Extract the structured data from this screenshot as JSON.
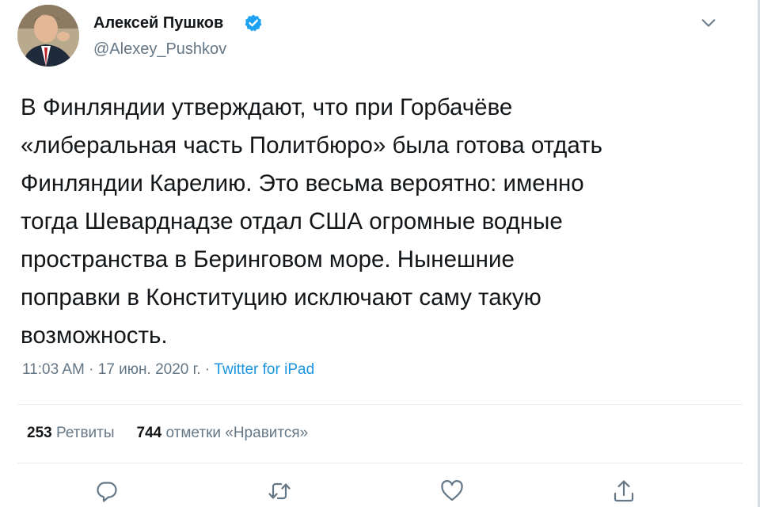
{
  "author": {
    "name": "Алексей Пушков",
    "handle": "@Alexey_Pushkov"
  },
  "tweet": {
    "text": "В Финляндии утверждают, что при Горбачёве\n«либеральная часть Политбюро» была готова отдать\nФинляндии Карелию. Это весьма вероятно: именно\nтогда Шеварднадзе отдал США огромные водные\nпространства в Беринговом море. Нынешние\nпоправки в Конституцию исключают саму такую\nвозможность."
  },
  "meta": {
    "time": "11:03 AM",
    "separator1": " · ",
    "date": "17 июн. 2020 г.",
    "separator2": " · ",
    "source": "Twitter for iPad"
  },
  "stats": {
    "retweets_count": "253",
    "retweets_label": "Ретвиты",
    "likes_count": "744",
    "likes_label": "отметки «Нравится»"
  },
  "colors": {
    "link": "#1b95e0",
    "secondary": "#657786",
    "verified": "#1da1f2",
    "divider": "#e6ecf0"
  },
  "icons": {
    "verified": "verified-badge-icon",
    "menu": "chevron-down-icon",
    "reply": "reply-icon",
    "retweet": "retweet-icon",
    "like": "heart-icon",
    "share": "share-icon"
  }
}
